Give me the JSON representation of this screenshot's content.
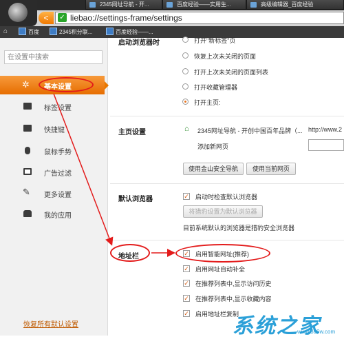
{
  "tabs": [
    {
      "label": "2345网址导航 - 开..."
    },
    {
      "label": "百度经验——实用生..."
    },
    {
      "label": "高级编辑器_百度经验"
    }
  ],
  "address": {
    "back_glyph": "<",
    "secure_glyph": "✓",
    "url": "liebao://settings-frame/settings"
  },
  "bookmarks": [
    {
      "label": "百度"
    },
    {
      "label": "2345积分联..."
    },
    {
      "label": "百度经验——..."
    }
  ],
  "sidebar": {
    "search_placeholder": "在设置中搜索",
    "items": [
      {
        "label": "基本设置",
        "icon": "gear-icon",
        "selected": true
      },
      {
        "label": "标签设置",
        "icon": "tab-icon"
      },
      {
        "label": "快捷键",
        "icon": "keyboard-icon"
      },
      {
        "label": "鼠标手势",
        "icon": "mouse-icon"
      },
      {
        "label": "广告过滤",
        "icon": "filter-icon"
      },
      {
        "label": "更多设置",
        "icon": "wrench-icon"
      },
      {
        "label": "我的应用",
        "icon": "puzzle-icon"
      }
    ],
    "restore_label": "恢复所有默认设置"
  },
  "startup": {
    "title": "启动浏览器时",
    "options": [
      {
        "label": "打开\"新标签\"页",
        "checked": false
      },
      {
        "label": "恢复上次未关闭的页面",
        "checked": false
      },
      {
        "label": "打开上次未关闭的页面列表",
        "checked": false
      },
      {
        "label": "打开收藏管理器",
        "checked": false
      },
      {
        "label": "打开主页:",
        "checked": true
      }
    ]
  },
  "homepage": {
    "title": "主页设置",
    "entry_label": "2345网址导航 - 开创中国百年品牌（...",
    "entry_url": "http://www.2",
    "add_label": "添加新网页",
    "btn_kingsoft": "使用金山安全导航",
    "btn_current": "使用当前网页"
  },
  "default_browser": {
    "title": "默认浏览器",
    "check_label": "启动时检查默认浏览器",
    "check_on": true,
    "btn_set_default": "将猎豹设置为默认浏览器",
    "status_text": "目前系统默认的浏览器是猎豹安全浏览器"
  },
  "address_bar": {
    "title": "地址栏",
    "options": [
      {
        "label": "启用智能网址(推荐)",
        "checked": true
      },
      {
        "label": "启用网址自动补全",
        "checked": true
      },
      {
        "label": "在推荐列表中,显示访问历史",
        "checked": true
      },
      {
        "label": "在推荐列表中,显示收藏内容",
        "checked": true
      },
      {
        "label": "启用地址栏复制",
        "checked": true
      }
    ]
  },
  "watermark": {
    "brand": "系统之家",
    "url": "www.306w.com"
  },
  "colors": {
    "accent": "#e8731e",
    "annotation": "#e31b1b"
  }
}
